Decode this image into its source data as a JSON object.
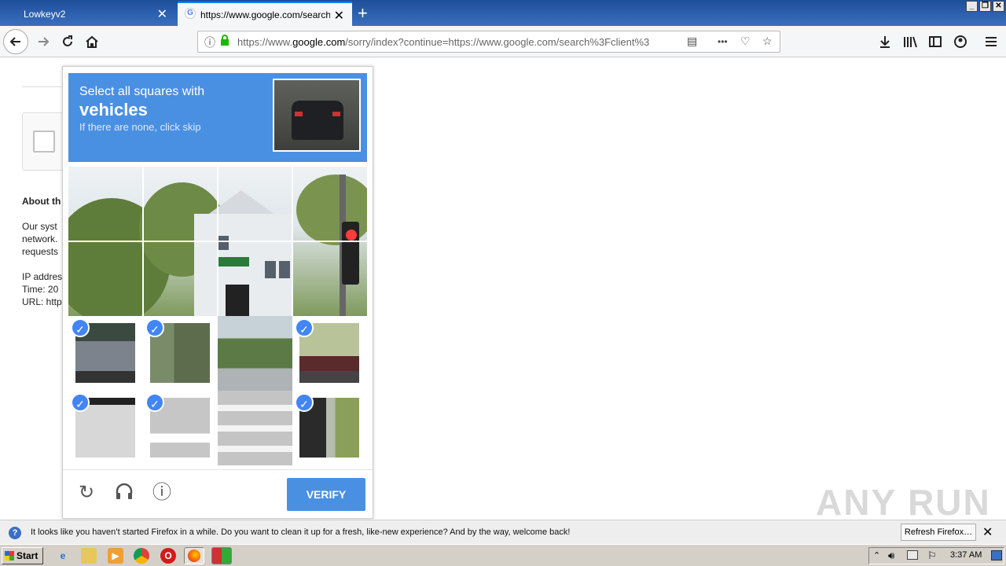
{
  "browser": {
    "tabs": [
      {
        "label": "Lowkeyv2",
        "active": false
      },
      {
        "label": "https://www.google.com/search?c",
        "active": true
      }
    ],
    "new_tab_glyph": "+",
    "close_glyph": "✕",
    "url_prefix": "https://www.",
    "url_domain": "google.com",
    "url_rest": "/sorry/index?continue=https://www.google.com/search%3Fclient%3",
    "more_glyph": "•••"
  },
  "page": {
    "about_heading": "About th",
    "lines": [
      "Our syst",
      "network.",
      "requests",
      "",
      "IP addres",
      "Time: 20",
      "URL: http"
    ]
  },
  "captcha": {
    "instruction_line1": "Select all squares with",
    "target": "vehicles",
    "instruction_line3": "If there are none, click skip",
    "verify_label": "VERIFY",
    "check_glyph": "✓",
    "selected_tiles": [
      8,
      9,
      11,
      12,
      13,
      15
    ]
  },
  "watermark": "ANY RUN",
  "notification": {
    "text": "It looks like you haven’t started Firefox in a while. Do you want to clean it up for a fresh, like-new experience? And by the way, welcome back!",
    "button": "Refresh Firefox…"
  },
  "taskbar": {
    "start_label": "Start",
    "clock": "3:37 AM"
  },
  "colors": {
    "captcha_blue": "#4a90e2",
    "check_blue": "#4285f4"
  }
}
